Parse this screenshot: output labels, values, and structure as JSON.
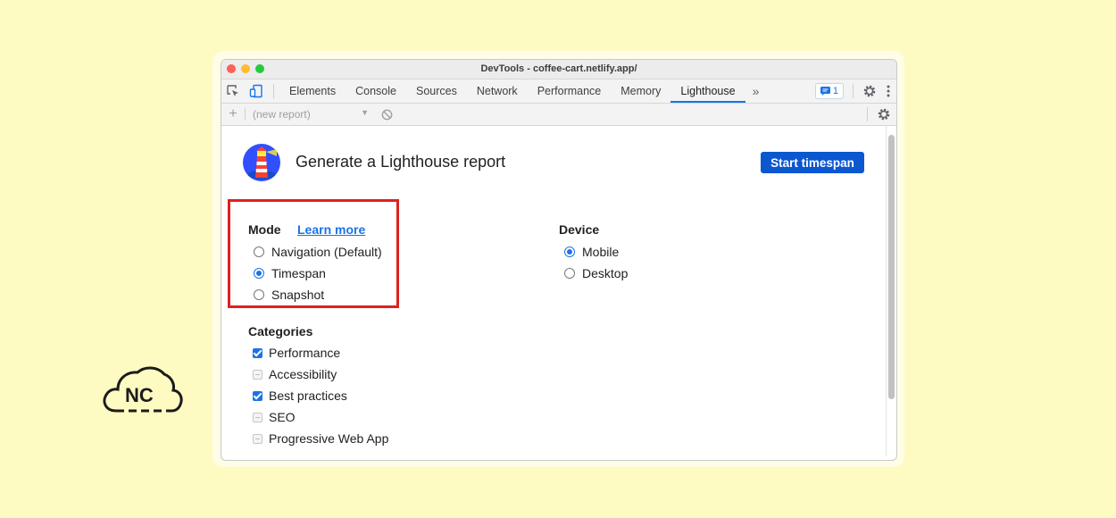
{
  "window": {
    "title": "DevTools - coffee-cart.netlify.app/"
  },
  "tabs": [
    {
      "label": "Elements",
      "active": false
    },
    {
      "label": "Console",
      "active": false
    },
    {
      "label": "Sources",
      "active": false
    },
    {
      "label": "Network",
      "active": false
    },
    {
      "label": "Performance",
      "active": false
    },
    {
      "label": "Memory",
      "active": false
    },
    {
      "label": "Lighthouse",
      "active": true
    }
  ],
  "issues_count": "1",
  "toolbar": {
    "report_select": "(new report)"
  },
  "main": {
    "heading": "Generate a Lighthouse report",
    "start_button": "Start timespan"
  },
  "mode": {
    "title": "Mode",
    "learn_more": "Learn more",
    "options": [
      {
        "label": "Navigation (Default)",
        "selected": false
      },
      {
        "label": "Timespan",
        "selected": true
      },
      {
        "label": "Snapshot",
        "selected": false
      }
    ]
  },
  "device": {
    "title": "Device",
    "options": [
      {
        "label": "Mobile",
        "selected": true
      },
      {
        "label": "Desktop",
        "selected": false
      }
    ]
  },
  "categories": {
    "title": "Categories",
    "items": [
      {
        "label": "Performance",
        "checked": true
      },
      {
        "label": "Accessibility",
        "checked": false
      },
      {
        "label": "Best practices",
        "checked": true
      },
      {
        "label": "SEO",
        "checked": false
      },
      {
        "label": "Progressive Web App",
        "checked": false
      }
    ]
  },
  "brand_logo": {
    "text": "NC"
  },
  "colors": {
    "background": "#fdfbc2",
    "accent": "#1a73e8",
    "button": "#0b57d0",
    "highlight": "#e02020"
  }
}
